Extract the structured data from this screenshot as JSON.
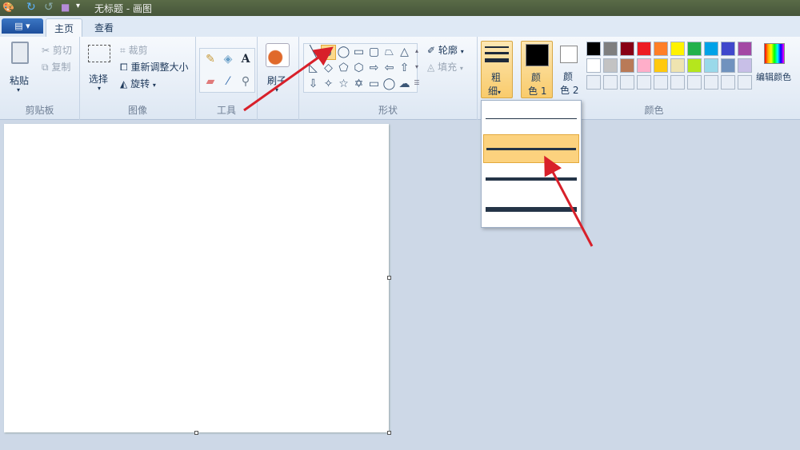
{
  "window": {
    "title": "无标题 - 画图"
  },
  "tabs": {
    "file_icon": "file-menu-icon",
    "home": "主页",
    "view": "查看"
  },
  "clipboard": {
    "paste": "粘贴",
    "cut": "剪切",
    "copy": "复制",
    "group": "剪贴板"
  },
  "image": {
    "select": "选择",
    "crop": "裁剪",
    "resize": "重新调整大小",
    "rotate": "旋转",
    "group": "图像"
  },
  "tools": {
    "group": "工具",
    "icons": [
      "pencil-icon",
      "fill-icon",
      "text-icon",
      "eraser-icon",
      "color-picker-icon",
      "magnifier-icon"
    ]
  },
  "brushes": {
    "label": "刷子"
  },
  "shapes": {
    "group": "形状",
    "outline": "轮廓",
    "fill": "填充",
    "selected": "curve",
    "items": [
      "line",
      "curve",
      "oval",
      "rectangle",
      "rounded-rectangle",
      "polygon",
      "triangle",
      "right-triangle",
      "diamond",
      "pentagon",
      "hexagon",
      "right-arrow",
      "left-arrow",
      "up-arrow",
      "down-arrow",
      "four-point-star",
      "five-point-star",
      "six-point-star",
      "rounded-callout",
      "oval-callout",
      "cloud-callout"
    ]
  },
  "size": {
    "label1": "粗",
    "label2": "细",
    "options_count": 4,
    "selected_index": 1
  },
  "colors": {
    "color1": "颜",
    "color1b": "色 1",
    "color2": "颜",
    "color2b": "色 2",
    "color1_value": "#000000",
    "color2_value": "#ffffff",
    "edit": "编辑颜色",
    "group": "颜色",
    "palette": [
      "#000000",
      "#7f7f7f",
      "#880015",
      "#ed1c24",
      "#ff7f27",
      "#fff200",
      "#22b14c",
      "#00a2e8",
      "#3f48cc",
      "#a349a4",
      "#ffffff",
      "#c3c3c3",
      "#b97a57",
      "#ffaec9",
      "#ffc90e",
      "#efe4b0",
      "#b5e61d",
      "#99d9ea",
      "#7092be",
      "#c8bfe7"
    ]
  },
  "annotation_color": "#d8202a"
}
